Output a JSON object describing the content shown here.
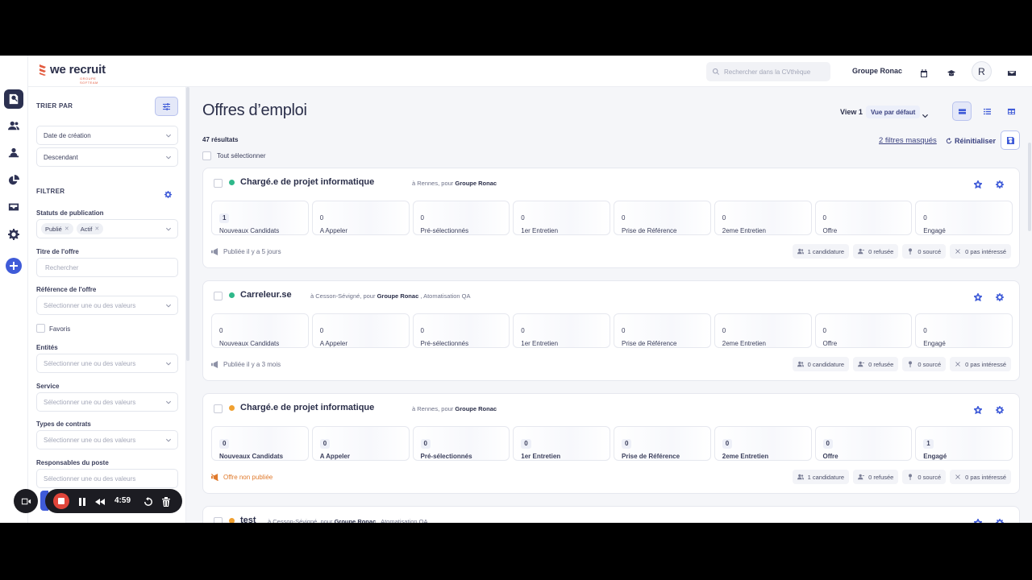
{
  "header": {
    "brand": "we recruit",
    "brand_sub": "GROUPE SOFTEAM",
    "search_placeholder": "Rechercher dans la CVthèque",
    "company": "Groupe Ronac",
    "avatar_initial": "R"
  },
  "sidebar": {
    "sort_title": "TRIER PAR",
    "sort_field": "Date de création",
    "sort_order": "Descendant",
    "filter_title": "FILTRER",
    "publication_status_label": "Statuts de publication",
    "publication_tags": [
      "Publié",
      "Actif"
    ],
    "offer_title_label": "Titre de l'offre",
    "offer_title_placeholder": "Rechercher",
    "offer_ref_label": "Référence de l'offre",
    "select_placeholder": "Sélectionner une ou des valeurs",
    "favorites_label": "Favoris",
    "entities_label": "Entités",
    "service_label": "Service",
    "contract_types_label": "Types de contrats",
    "managers_label": "Responsables du poste"
  },
  "main": {
    "title": "Offres d’emploi",
    "view_label": "View 1",
    "view_default": "Vue par défaut",
    "results": "47 résultats",
    "select_all": "Tout sélectionner",
    "hidden_filters": "2 filtres masqués",
    "reset": "Réinitialiser"
  },
  "stage_labels": [
    "Nouveaux Candidats",
    "A Appeler",
    "Pré-sélectionnés",
    "1er Entretien",
    "Prise de Référence",
    "2eme Entretien",
    "Offre",
    "Engagé"
  ],
  "jobs": [
    {
      "title": "Chargé.e de projet informatique",
      "location_prefix": "à Rennes, pour",
      "company": "Groupe Ronac",
      "extra": "",
      "status_color": "#2fb88a",
      "counts": [
        "1",
        "0",
        "0",
        "0",
        "0",
        "0",
        "0",
        "0"
      ],
      "published": "Publiée il y a 5 jours",
      "stats": [
        "1 candidature",
        "0 refusée",
        "0 sourcé",
        "0 pas intéressé"
      ]
    },
    {
      "title": "Carreleur.se",
      "location_prefix": "à Cesson-Sévigné, pour",
      "company": "Groupe Ronac",
      "extra": ", Atomatisation QA",
      "status_color": "#2fb88a",
      "counts": [
        "0",
        "0",
        "0",
        "0",
        "0",
        "0",
        "0",
        "0"
      ],
      "published": "Publiée il y a 3 mois",
      "stats": [
        "0 candidature",
        "0 refusée",
        "0 sourcé",
        "0 pas intéressé"
      ]
    },
    {
      "title": "Chargé.e de projet informatique",
      "location_prefix": "à Rennes, pour",
      "company": "Groupe Ronac",
      "extra": "",
      "status_color": "#f0a030",
      "counts": [
        "0",
        "0",
        "0",
        "0",
        "0",
        "0",
        "0",
        "1"
      ],
      "published": "Offre non publiée",
      "stats": [
        "1 candidature",
        "0 refusée",
        "0 sourcé",
        "0 pas intéressé"
      ]
    },
    {
      "title": "test",
      "location_prefix": "à Cesson-Sévigné, pour",
      "company": "Groupe Ronac",
      "extra": ", Atomatisation QA",
      "status_color": "#f0a030"
    }
  ],
  "recorder": {
    "time": "4:59"
  },
  "colors": {
    "accent": "#3f5bd8",
    "published": "#2fb88a",
    "unpublished": "#f0a030"
  }
}
